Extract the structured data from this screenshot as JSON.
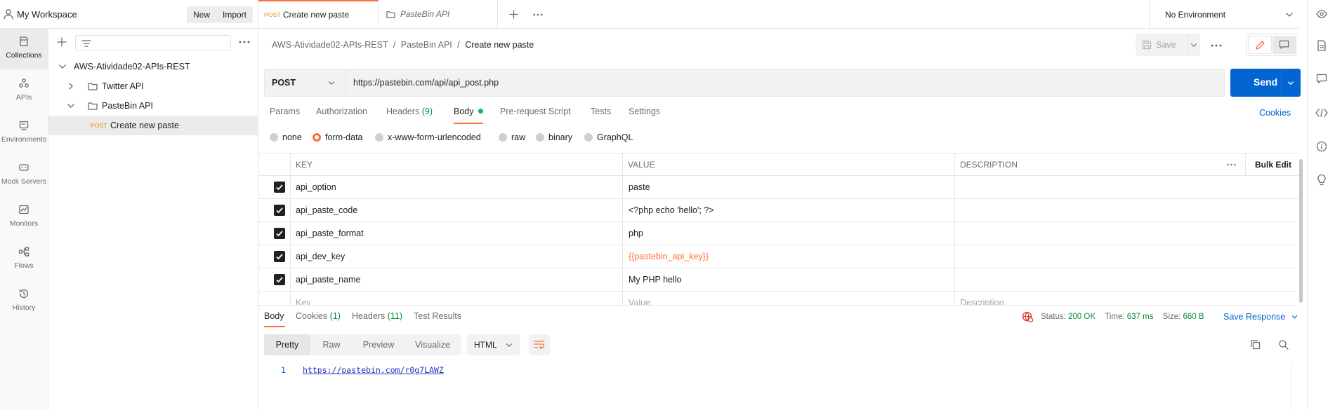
{
  "workspace": {
    "title": "My Workspace",
    "new_label": "New",
    "import_label": "Import"
  },
  "rail": {
    "items": [
      {
        "label": "Collections",
        "icon": "collections-icon"
      },
      {
        "label": "APIs",
        "icon": "apis-icon"
      },
      {
        "label": "Environments",
        "icon": "environments-icon"
      },
      {
        "label": "Mock Servers",
        "icon": "mock-servers-icon"
      },
      {
        "label": "Monitors",
        "icon": "monitors-icon"
      },
      {
        "label": "Flows",
        "icon": "flows-icon"
      },
      {
        "label": "History",
        "icon": "history-icon"
      }
    ]
  },
  "sidebar": {
    "collection": "AWS-Atividade02-APIs-REST",
    "folders": [
      {
        "label": "Twitter API"
      },
      {
        "label": "PasteBin API"
      }
    ],
    "request": {
      "method": "POST",
      "label": "Create new paste"
    }
  },
  "tabs": [
    {
      "method": "POST",
      "label": "Create new paste"
    },
    {
      "label": "PasteBin API"
    }
  ],
  "environment": "No Environment",
  "breadcrumb": {
    "root": "AWS-Atividade02-APIs-REST",
    "folder": "PasteBin API",
    "current": "Create new paste"
  },
  "toolbar": {
    "save_label": "Save"
  },
  "request": {
    "method": "POST",
    "url": "https://pastebin.com/api/api_post.php",
    "send_label": "Send",
    "tabs": {
      "params": "Params",
      "authorization": "Authorization",
      "headers": "Headers",
      "headers_count": "(9)",
      "body": "Body",
      "prerequest": "Pre-request Script",
      "tests": "Tests",
      "settings": "Settings"
    },
    "cookies_label": "Cookies",
    "body_types": [
      "none",
      "form-data",
      "x-www-form-urlencoded",
      "raw",
      "binary",
      "GraphQL"
    ]
  },
  "kv_table": {
    "headers": {
      "key": "KEY",
      "value": "VALUE",
      "description": "DESCRIPTION",
      "bulk_edit": "Bulk Edit"
    },
    "rows": [
      {
        "key": "api_option",
        "value": "paste"
      },
      {
        "key": "api_paste_code",
        "value": "<?php echo 'hello'; ?>"
      },
      {
        "key": "api_paste_format",
        "value": "php"
      },
      {
        "key": "api_dev_key",
        "value": "{{pastebin_api_key}}"
      },
      {
        "key": "api_paste_name",
        "value": "My PHP hello"
      }
    ],
    "placeholders": {
      "key": "Key",
      "value": "Value",
      "description": "Description"
    }
  },
  "response": {
    "tabs": {
      "body": "Body",
      "cookies": "Cookies",
      "cookies_count": "(1)",
      "headers": "Headers",
      "headers_count": "(11)",
      "tests": "Test Results"
    },
    "status_label": "Status:",
    "status_value": "200 OK",
    "time_label": "Time:",
    "time_value": "637 ms",
    "size_label": "Size:",
    "size_value": "660 B",
    "save_label": "Save Response",
    "views": [
      "Pretty",
      "Raw",
      "Preview",
      "Visualize"
    ],
    "format": "HTML",
    "line_number": "1",
    "body_line": "https://pastebin.com/r0g7LAWZ"
  },
  "colors": {
    "accent": "#ff6c37",
    "primary": "#0265d2",
    "success": "#0a8a3a"
  }
}
